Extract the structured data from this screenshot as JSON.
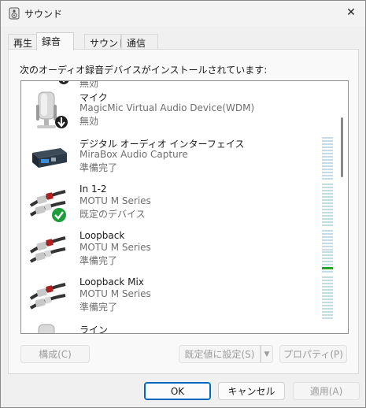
{
  "window": {
    "title": "サウンド",
    "close_glyph": "✕"
  },
  "tabs": [
    {
      "label": "再生"
    },
    {
      "label": "録音"
    },
    {
      "label": "サウンド"
    },
    {
      "label": "通信"
    }
  ],
  "active_tab": "録音",
  "panel": {
    "label": "次のオーディオ録音デバイスがインストールされています:"
  },
  "partial_top_status": "無効",
  "devices": [
    {
      "name": "マイク",
      "description": "MagicMic Virtual Audio Device(WDM)",
      "status": "無効",
      "icon": "microphone-icon",
      "badge": "disabled-arrow"
    },
    {
      "name": "デジタル オーディオ インターフェイス",
      "description": "MiraBox Audio Capture",
      "status": "準備完了",
      "icon": "capture-device-icon",
      "badge": null
    },
    {
      "name": "In 1-2",
      "description": "MOTU M Series",
      "status": "既定のデバイス",
      "icon": "rca-cable-icon",
      "badge": "default-check"
    },
    {
      "name": "Loopback",
      "description": "MOTU M Series",
      "status": "準備完了",
      "icon": "rca-cable-icon",
      "badge": null,
      "level": 0.1
    },
    {
      "name": "Loopback Mix",
      "description": "MOTU M Series",
      "status": "準備完了",
      "icon": "rca-cable-icon",
      "badge": null
    },
    {
      "name": "ライン",
      "description": "",
      "status": "",
      "icon": "microphone-icon",
      "badge": null
    }
  ],
  "panel_buttons": {
    "configure": "構成(C)",
    "set_default": "既定値に設定(S)",
    "properties": "プロパティ(P)"
  },
  "footer_buttons": {
    "ok": "OK",
    "cancel": "キャンセル",
    "apply": "適用(A)"
  },
  "colors": {
    "accent": "#0067c0",
    "default_check": "#1e9e3a",
    "meter_on": "#2aa12a",
    "meter_off": "#c5dbe7"
  }
}
